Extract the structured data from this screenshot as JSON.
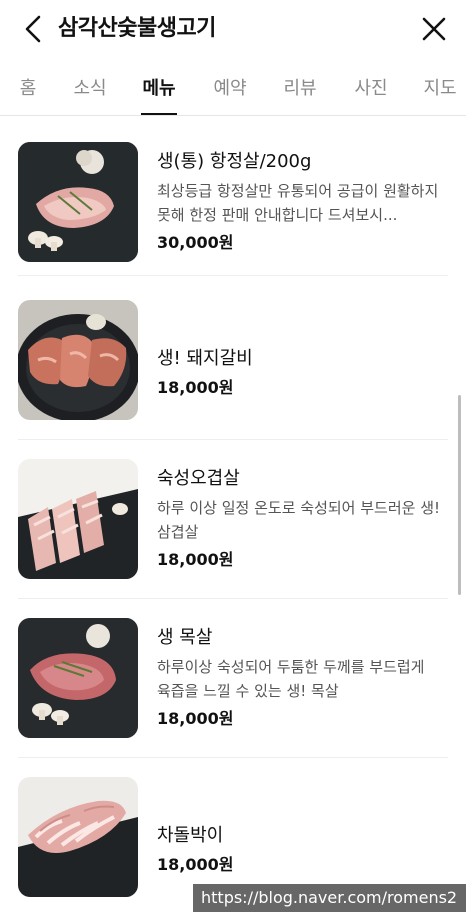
{
  "header": {
    "title": "삼각산숯불생고기",
    "back_icon": "chevron-left-icon",
    "close_icon": "close-icon"
  },
  "tabs": [
    {
      "label": "홈",
      "active": false
    },
    {
      "label": "소식",
      "active": false
    },
    {
      "label": "메뉴",
      "active": true
    },
    {
      "label": "예약",
      "active": false
    },
    {
      "label": "리뷰",
      "active": false
    },
    {
      "label": "사진",
      "active": false
    },
    {
      "label": "지도",
      "active": false
    }
  ],
  "menu": {
    "items": [
      {
        "name": "생(통) 항정살/200g",
        "description": "최상등급 항정살만 유통되어 공급이 원활하지 못해 한정 판매 안내합니다 드셔보시...",
        "price": "30,000원"
      },
      {
        "name": "생! 돼지갈비",
        "description": "",
        "price": "18,000원"
      },
      {
        "name": "숙성오겹살",
        "description": "하루 이상 일정 온도로 숙성되어 부드러운 생!삼겹살",
        "price": "18,000원"
      },
      {
        "name": "생 목살",
        "description": "하루이상 숙성되어 두툼한 두께를 부드럽게 육즙을 느낄 수 있는 생! 목살",
        "price": "18,000원"
      },
      {
        "name": "차돌박이",
        "description": "",
        "price": "18,000원"
      }
    ]
  },
  "watermark": "https://blog.naver.com/romens2"
}
